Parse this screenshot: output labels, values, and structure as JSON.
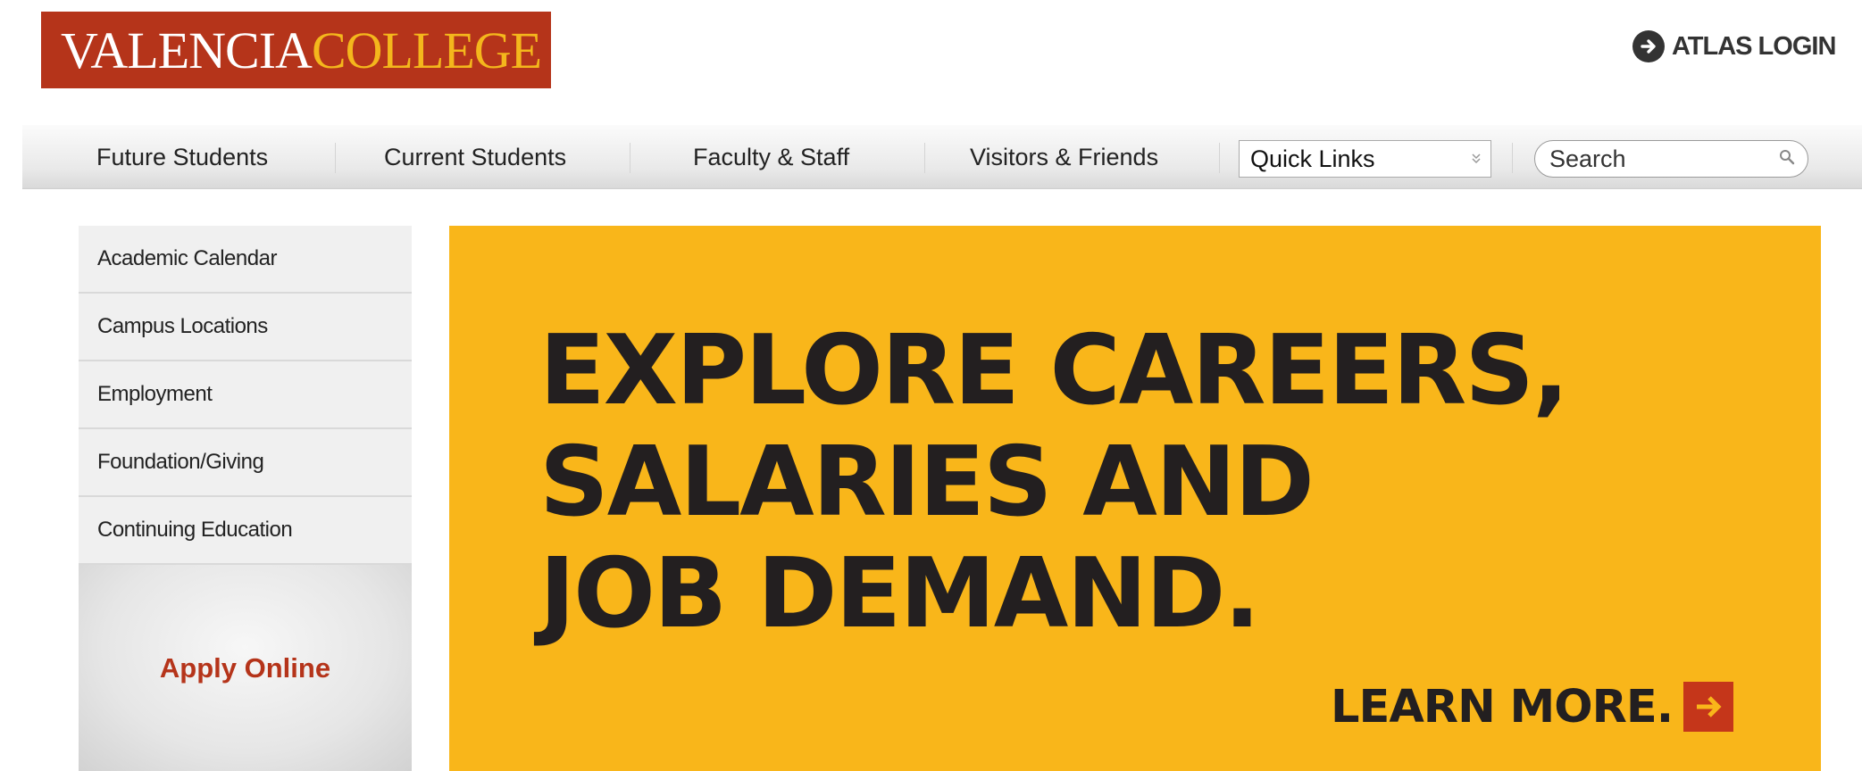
{
  "logo": {
    "word1": "VALENCIA",
    "word2": "COLLEGE"
  },
  "header": {
    "login_label": "ATLAS LOGIN"
  },
  "nav": {
    "items": [
      {
        "label": "Future Students"
      },
      {
        "label": "Current Students"
      },
      {
        "label": "Faculty & Staff"
      },
      {
        "label": "Visitors & Friends"
      }
    ],
    "quick_links": {
      "selected": "Quick Links"
    },
    "search": {
      "placeholder": "Search"
    }
  },
  "sidebar": {
    "items": [
      {
        "label": "Academic Calendar"
      },
      {
        "label": "Campus Locations"
      },
      {
        "label": "Employment"
      },
      {
        "label": "Foundation/Giving"
      },
      {
        "label": "Continuing Education"
      }
    ],
    "apply_label": "Apply Online"
  },
  "hero": {
    "lines": [
      "EXPLORE CAREERS,",
      "SALARIES AND",
      "JOB DEMAND."
    ],
    "cta": "LEARN MORE."
  },
  "colors": {
    "brand_red": "#b5341a",
    "brand_gold": "#f4b71c",
    "hero_bg": "#f9b61a",
    "hero_text": "#231f20"
  }
}
